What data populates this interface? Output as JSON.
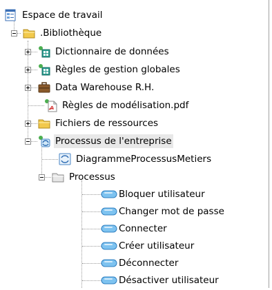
{
  "tree": {
    "root": {
      "label": "Espace de travail",
      "icon": "workspace-icon"
    },
    "library": {
      "label": ".Bibliothèque",
      "icon": "folder-icon"
    },
    "library_items": [
      {
        "label": "Dictionnaire de données",
        "icon": "data-dictionary-icon",
        "expander": "plus"
      },
      {
        "label": "Règles de gestion globales",
        "icon": "business-rules-icon",
        "expander": "plus"
      },
      {
        "label": "Data Warehouse R.H.",
        "icon": "briefcase-icon",
        "expander": "plus"
      },
      {
        "label": "Règles de modélisation.pdf",
        "icon": "pdf-file-icon",
        "expander": "none"
      },
      {
        "label": "Fichiers de ressources",
        "icon": "folder-icon",
        "expander": "plus"
      },
      {
        "label": "Processus de l'entreprise",
        "icon": "process-model-icon",
        "expander": "minus"
      }
    ],
    "process_children": {
      "diagram": {
        "label": "DiagrammeProcessusMetiers",
        "icon": "process-diagram-icon"
      },
      "package": {
        "label": "Processus",
        "icon": "package-folder-icon"
      }
    },
    "processes": [
      "Bloquer utilisateur",
      "Changer mot de passe",
      "Connecter",
      "Créer utilisateur",
      "Déconnecter",
      "Désactiver utilisateur"
    ],
    "selected_item": "Processus de l'entreprise"
  },
  "colors": {
    "folder": "#f2c94c",
    "process_pill": "#7ec3f0",
    "selection": "#e8e8e8"
  }
}
